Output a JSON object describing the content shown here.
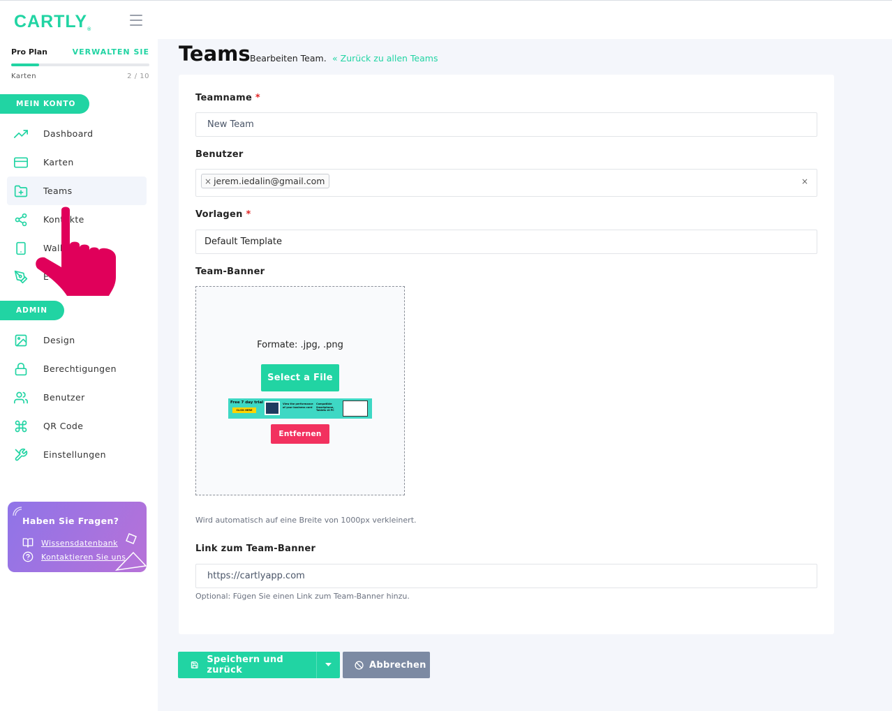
{
  "app": {
    "logo_text": "CARTLY",
    "logo_mark": "®"
  },
  "plan": {
    "name": "Pro Plan",
    "manage_label": "VERWALTEN SIE",
    "usage_label": "Karten",
    "usage_count": "2 / 10",
    "usage_fraction": 0.2
  },
  "sidebar": {
    "section_account": "MEIN KONTO",
    "section_admin": "ADMIN",
    "account_items": [
      {
        "label": "Dashboard",
        "icon": "trending-up-icon"
      },
      {
        "label": "Karten",
        "icon": "credit-card-icon"
      },
      {
        "label": "Teams",
        "icon": "folder-plus-icon"
      },
      {
        "label": "Kontakte",
        "icon": "share-icon"
      },
      {
        "label": "Wallet",
        "icon": "smartphone-icon"
      },
      {
        "label": "E-Mail",
        "icon": "pen-tool-icon"
      }
    ],
    "admin_items": [
      {
        "label": "Design",
        "icon": "image-icon"
      },
      {
        "label": "Berechtigungen",
        "icon": "lock-icon"
      },
      {
        "label": "Benutzer",
        "icon": "users-icon"
      },
      {
        "label": "QR Code",
        "icon": "command-icon"
      },
      {
        "label": "Einstellungen",
        "icon": "tools-icon"
      }
    ],
    "active_item": "Teams"
  },
  "help": {
    "title": "Haben Sie Fragen?",
    "knowledge_link": "Wissensdatenbank",
    "contact_link": "Kontaktieren Sie uns"
  },
  "header": {
    "title": "Teams",
    "subtitle": "Bearbeiten Team.",
    "back_link": "Zurück zu allen Teams",
    "back_icon": "double-chevron-left-icon"
  },
  "form": {
    "team_name": {
      "label": "Teamname",
      "required_mark": "*",
      "value": "New Team"
    },
    "users": {
      "label": "Benutzer",
      "tags": [
        "jerem.iedalin@gmail.com"
      ],
      "tag_remove": "×",
      "clear": "×"
    },
    "templates": {
      "label": "Vorlagen",
      "required_mark": "*",
      "value": "Default Template"
    },
    "banner": {
      "label": "Team-Banner",
      "formats": "Formate: .jpg, .png",
      "select_button": "Select a File",
      "remove_button": "Entfernen",
      "hint": "Wird automatisch auf eine Breite von 1000px verkleinert.",
      "thumb_texts": [
        "Free 7 day trial",
        "CLICK HERE",
        "View the performance of your business card",
        "Compatible Smartphone, Tablets et PC"
      ]
    },
    "banner_link": {
      "label": "Link zum Team-Banner",
      "value": "https://cartlyapp.com",
      "hint": "Optional: Fügen Sie einen Link zum Team-Banner hinzu."
    }
  },
  "actions": {
    "save_label": "Speichern und zurück",
    "save_icon": "save-icon",
    "cancel_label": "Abbrechen",
    "cancel_icon": "ban-icon"
  },
  "colors": {
    "accent": "#21d4a3",
    "danger": "#f2315f",
    "cancel": "#7c8aa3",
    "pointer": "#e0005a",
    "help_gradient_start": "#8f74e8",
    "help_gradient_end": "#b772d8"
  }
}
